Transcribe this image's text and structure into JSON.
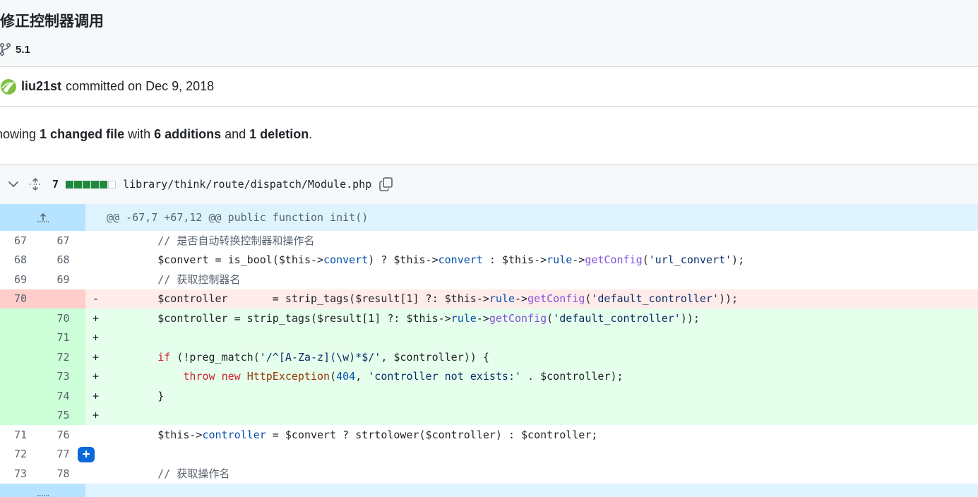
{
  "commit": {
    "title": "修正控制器调用",
    "branch": "5.1",
    "author": "liu21st",
    "committed_text": "committed on Dec 9, 2018"
  },
  "summary": {
    "prefix": "howing ",
    "changed": "1 changed file",
    "with": " with ",
    "additions": "6 additions",
    "and": " and ",
    "deletions": "1 deletion",
    "end": "."
  },
  "file": {
    "change_count": "7",
    "path": "library/think/route/dispatch/Module.php",
    "stat": [
      "add",
      "add",
      "add",
      "add",
      "add",
      "neutral"
    ]
  },
  "hunk": {
    "header": "@@ -67,7 +67,12 @@ public function init()"
  },
  "lines": {
    "l67": {
      "old": "67",
      "new": "67",
      "sign": "",
      "text": "        // 是否自动转换控制器和操作名"
    },
    "l68": {
      "old": "68",
      "new": "68",
      "sign": ""
    },
    "l69": {
      "old": "69",
      "new": "69",
      "sign": "",
      "text": "        // 获取控制器名"
    },
    "d70": {
      "old": "70",
      "new": "",
      "sign": "-"
    },
    "a70": {
      "old": "",
      "new": "70",
      "sign": "+"
    },
    "a71": {
      "old": "",
      "new": "71",
      "sign": "+"
    },
    "a72": {
      "old": "",
      "new": "72",
      "sign": "+"
    },
    "a73": {
      "old": "",
      "new": "73",
      "sign": "+"
    },
    "a74": {
      "old": "",
      "new": "74",
      "sign": "+",
      "text": "        }"
    },
    "a75": {
      "old": "",
      "new": "75",
      "sign": "+"
    },
    "l71": {
      "old": "71",
      "new": "76",
      "sign": ""
    },
    "l72": {
      "old": "72",
      "new": "77",
      "sign": ""
    },
    "l73": {
      "old": "73",
      "new": "78",
      "sign": "",
      "text": "        // 获取操作名"
    }
  },
  "code_tokens": {
    "c68": [
      "        $convert = is_bool($this->",
      "convert",
      ") ? $this->",
      "convert",
      " : $this->",
      "rule",
      "->",
      "getConfig",
      "(",
      "'url_convert'",
      ");"
    ],
    "c70d": [
      "        $controller       = strip_tags($result[1] ?: $this->",
      "rule",
      "->",
      "getConfig",
      "(",
      "'default_controller'",
      "));"
    ],
    "c70a": [
      "        $controller = strip_tags($result[1] ?: $this->",
      "rule",
      "->",
      "getConfig",
      "(",
      "'default_controller'",
      "));"
    ],
    "c72": [
      "        ",
      "if",
      " (!preg_match(",
      "'/^[A-Za-z](\\w)*$/'",
      ", $controller)) {"
    ],
    "c73": [
      "            ",
      "throw",
      " ",
      "new",
      " ",
      "HttpException",
      "(",
      "404",
      ", ",
      "'controller not exists:'",
      " . $controller);"
    ],
    "c76": [
      "        $this->",
      "controller",
      " = $convert ? strtolower($controller) : $controller;"
    ]
  },
  "colors": {
    "accent": "#0969da",
    "addition": "#1f883d",
    "hunk_bg": "#ddf4ff",
    "del_bg": "#ffebe9",
    "add_bg": "#e6ffec"
  }
}
